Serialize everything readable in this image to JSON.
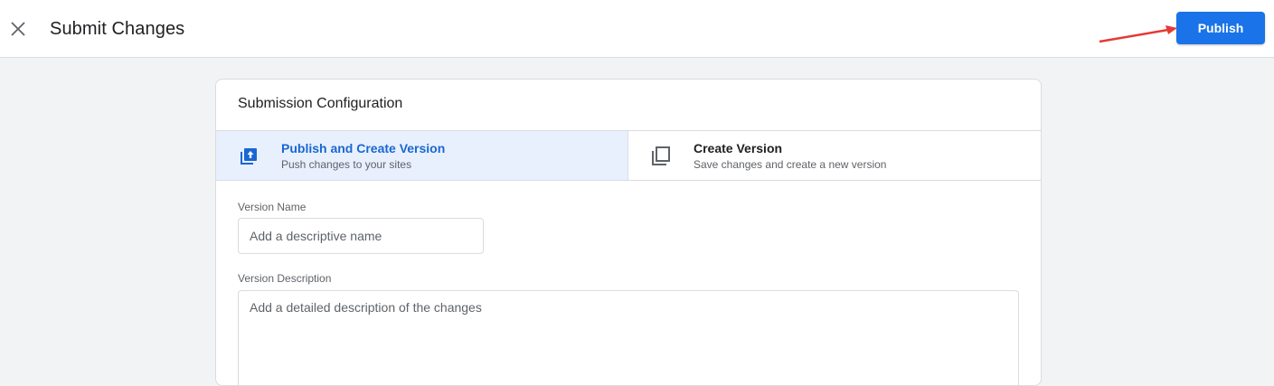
{
  "header": {
    "close_icon": "close-icon",
    "title": "Submit Changes",
    "publish_label": "Publish",
    "accent": "#1a73e8"
  },
  "config": {
    "title": "Submission Configuration",
    "options": [
      {
        "title": "Publish and Create Version",
        "subtitle": "Push changes to your sites",
        "icon": "publish-upload-icon",
        "selected": true
      },
      {
        "title": "Create Version",
        "subtitle": "Save changes and create a new version",
        "icon": "copy-version-icon",
        "selected": false
      }
    ],
    "version_name": {
      "label": "Version Name",
      "placeholder": "Add a descriptive name",
      "value": ""
    },
    "version_description": {
      "label": "Version Description",
      "placeholder": "Add a detailed description of the changes",
      "value": ""
    }
  },
  "annotation": {
    "arrow_color": "#e53935"
  }
}
